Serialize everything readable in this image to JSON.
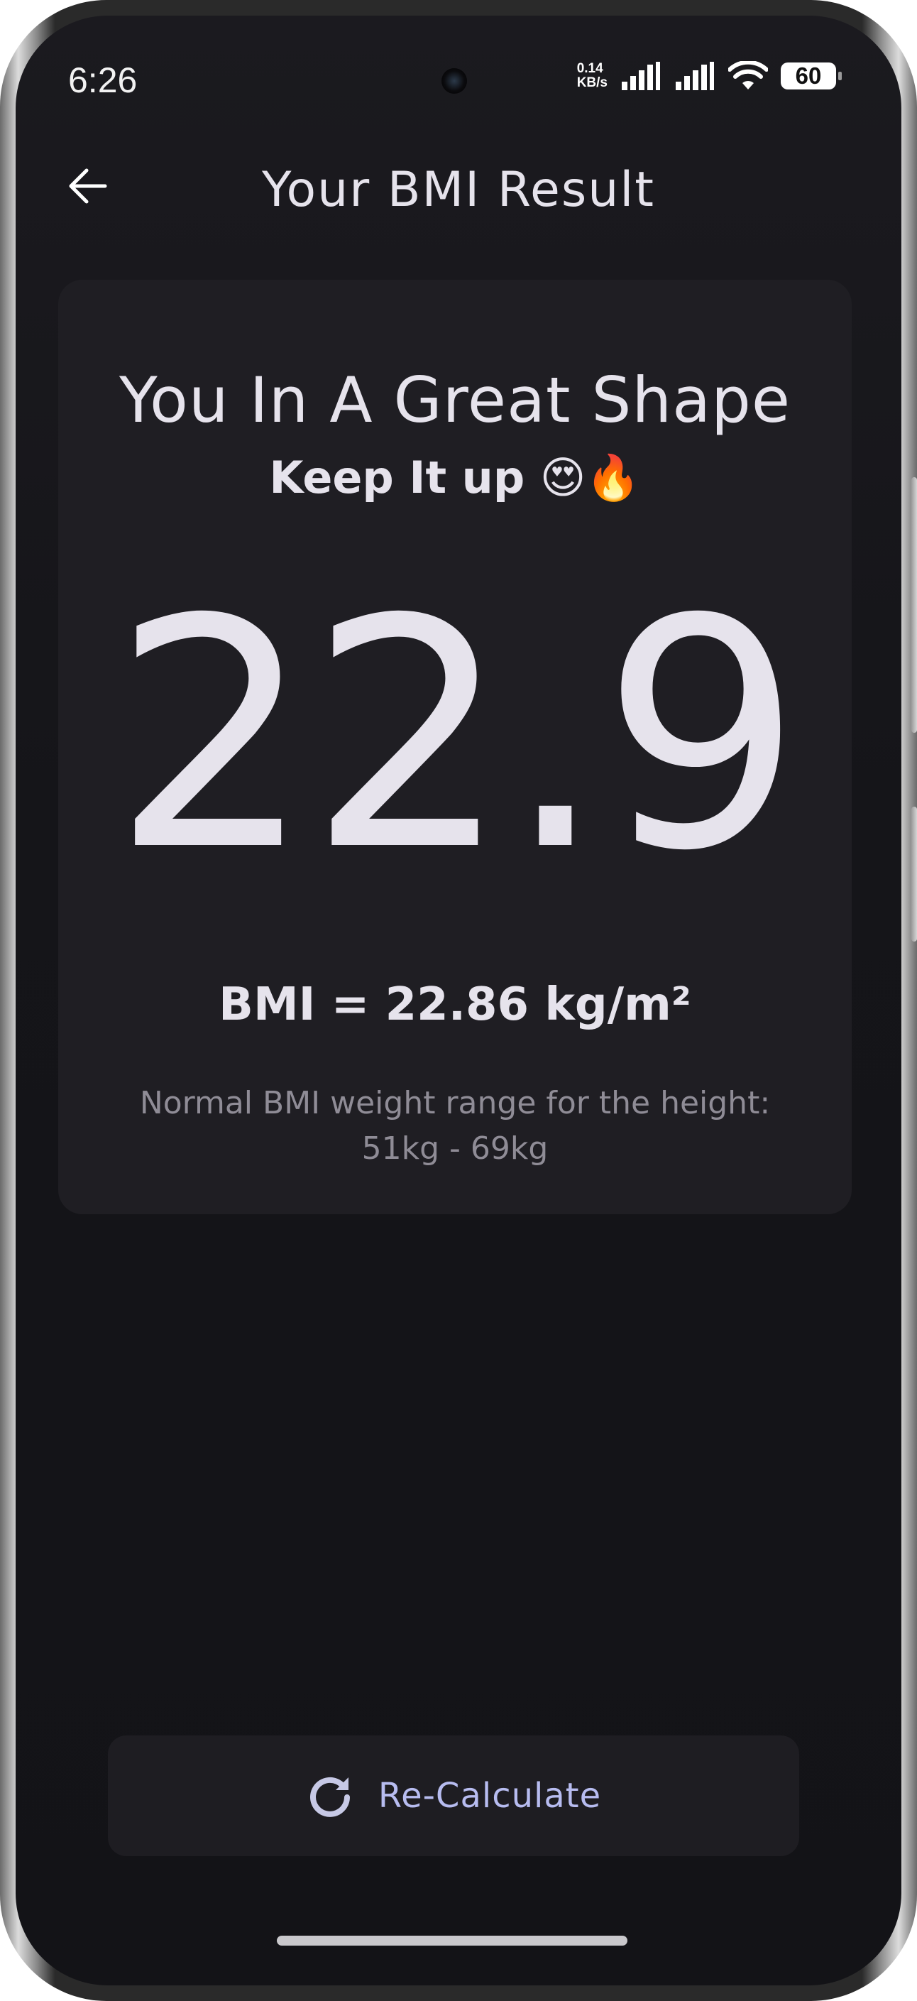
{
  "status_bar": {
    "time": "6:26",
    "net_speed_value": "0.14",
    "net_speed_unit": "KB/s",
    "battery": "60",
    "icons": [
      "signal-icon",
      "signal-icon",
      "wifi-icon",
      "battery-icon"
    ]
  },
  "app_bar": {
    "back_icon": "arrow-left-icon",
    "title": "Your BMI Result"
  },
  "result": {
    "headline": "You In A Great Shape",
    "subline": "Keep It up 😍🔥",
    "bmi_rounded": "22.9",
    "bmi_formula": "BMI = 22.86 kg/m²",
    "range_label": "Normal BMI weight range for the height:",
    "range_value": "51kg - 69kg"
  },
  "actions": {
    "recalculate_icon": "refresh-icon",
    "recalculate_label": "Re-Calculate",
    "accent_color": "#b7bcf0"
  },
  "colors": {
    "background": "#151519",
    "card": "#1f1e23",
    "text_primary": "#e6e3ec",
    "text_secondary": "#8f8c96"
  }
}
